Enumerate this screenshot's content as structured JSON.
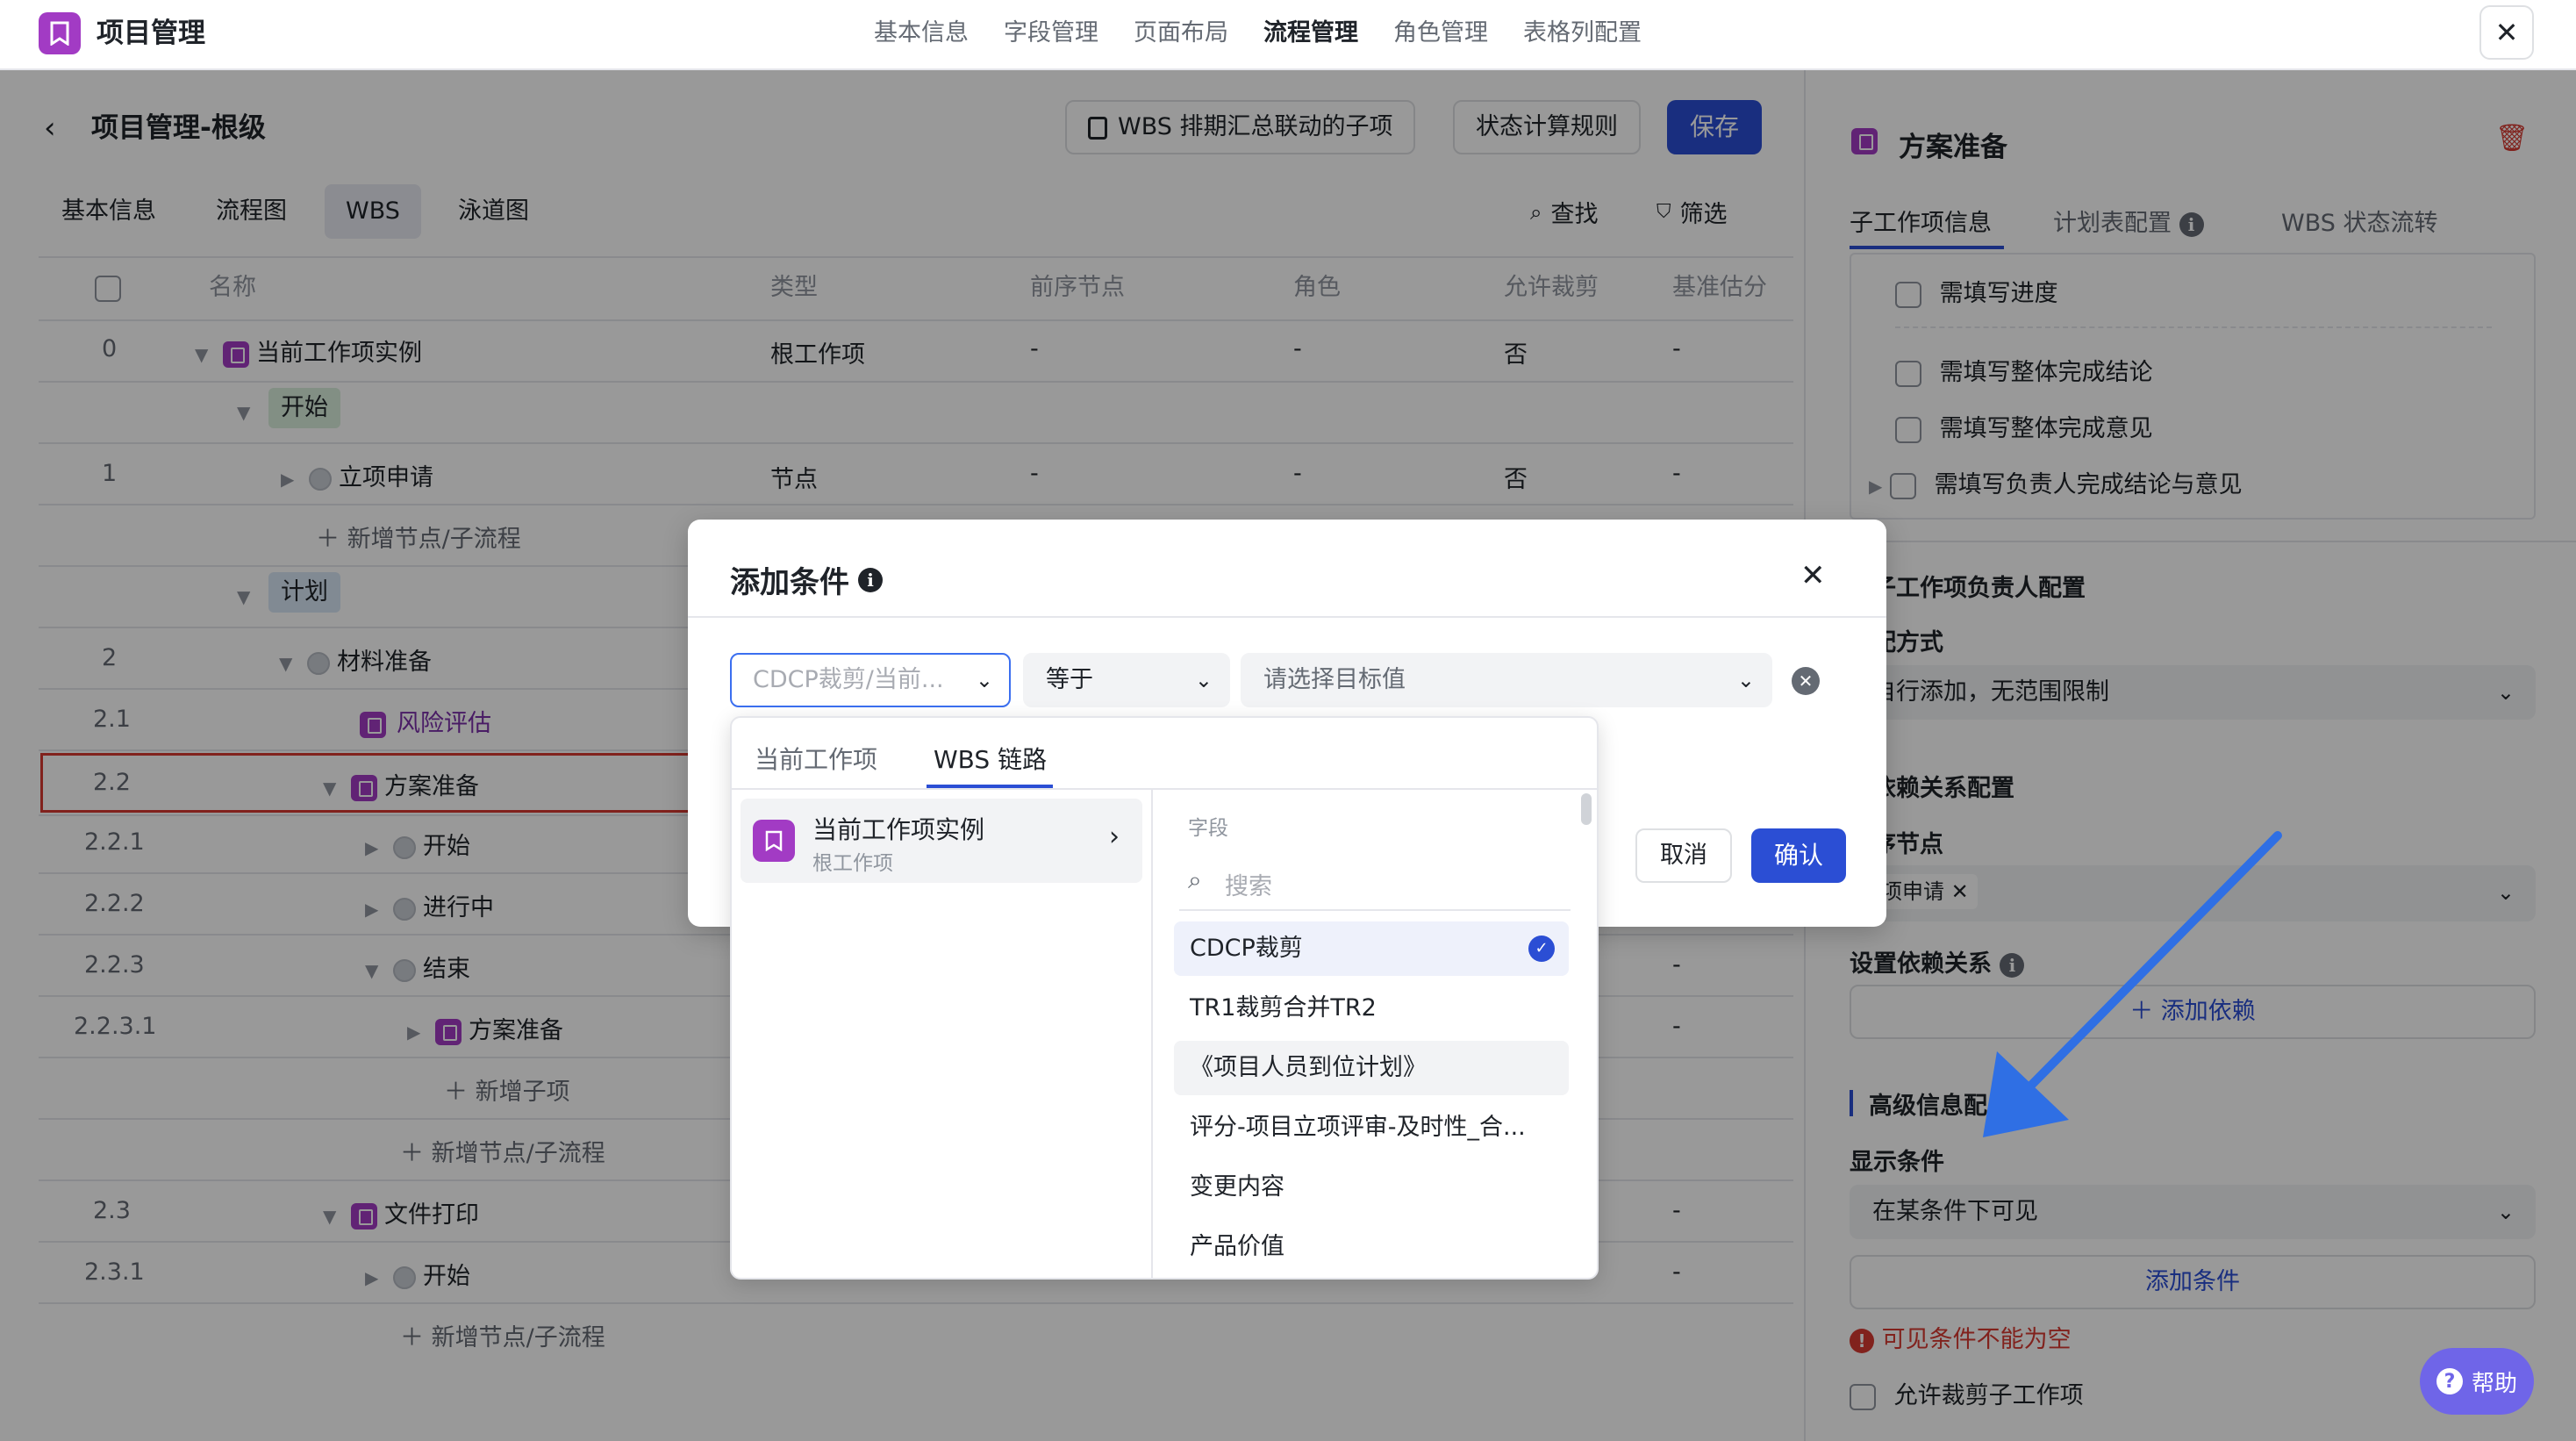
{
  "app": {
    "title": "项目管理"
  },
  "top_nav": [
    "基本信息",
    "字段管理",
    "页面布局",
    "流程管理",
    "角色管理",
    "表格列配置"
  ],
  "top_nav_active": "流程管理",
  "header": {
    "title": "项目管理-根级",
    "btn_wbs": "WBS 排期汇总联动的子项",
    "btn_rule": "状态计算规则",
    "btn_save": "保存"
  },
  "view_tabs": [
    "基本信息",
    "流程图",
    "WBS",
    "泳道图"
  ],
  "view_tab_active": "WBS",
  "tools": {
    "find": "查找",
    "filter": "筛选"
  },
  "table": {
    "columns": [
      "名称",
      "类型",
      "前序节点",
      "角色",
      "允许裁剪",
      "基准估分"
    ],
    "rows": [
      {
        "num": "0",
        "name": "当前工作项实例",
        "type": "根工作项",
        "pre": "-",
        "role": "-",
        "cut": "否",
        "est": "-"
      },
      {
        "phase": "开始"
      },
      {
        "num": "1",
        "name": "立项申请",
        "type": "节点",
        "pre": "-",
        "role": "-",
        "cut": "否",
        "est": "-"
      },
      {
        "add": "新增节点/子流程"
      },
      {
        "phase": "计划"
      },
      {
        "num": "2",
        "name": "材料准备"
      },
      {
        "num": "2.1",
        "name": "风险评估"
      },
      {
        "num": "2.2",
        "name": "方案准备"
      },
      {
        "num": "2.2.1",
        "name": "开始"
      },
      {
        "num": "2.2.2",
        "name": "进行中"
      },
      {
        "num": "2.2.3",
        "name": "结束",
        "est": "-"
      },
      {
        "num": "2.2.3.1",
        "name": "方案准备",
        "est": "-"
      },
      {
        "add": "新增子项"
      },
      {
        "add": "新增节点/子流程"
      },
      {
        "num": "2.3",
        "name": "文件打印",
        "est": "-"
      },
      {
        "num": "2.3.1",
        "name": "开始",
        "est": "-"
      },
      {
        "add": "新增节点/子流程"
      }
    ]
  },
  "right_panel": {
    "title": "方案准备",
    "tabs": [
      "子工作项信息",
      "计划表配置",
      "WBS 状态流转"
    ],
    "checks": [
      "需填写进度",
      "需填写整体完成结论",
      "需填写整体完成意见",
      "需填写负责人完成结论与意见"
    ],
    "owner_section": "子工作项负责人配置",
    "method_label": "配方式",
    "method_value": "自行添加，无范围限制",
    "dep_section": "依赖关系配置",
    "pre_label": "序节点",
    "pre_tag": "立项申请",
    "set_dep_label": "设置依赖关系",
    "add_dep": "添加依赖",
    "adv_section": "高级信息配",
    "show_cond_label": "显示条件",
    "show_cond_value": "在某条件下可见",
    "add_cond": "添加条件",
    "error": "可见条件不能为空",
    "allow_cut": "允许裁剪子工作项",
    "help": "帮助"
  },
  "modal": {
    "title": "添加条件",
    "field_placeholder": "CDCP裁剪/当前...",
    "operator": "等于",
    "target_placeholder": "请选择目标值",
    "cancel": "取消",
    "confirm": "确认"
  },
  "dropdown": {
    "tabs": [
      "当前工作项",
      "WBS 链路"
    ],
    "active_tab": "WBS 链路",
    "item_title": "当前工作项实例",
    "item_sub": "根工作项",
    "field_header": "字段",
    "search_placeholder": "搜索",
    "fields": [
      "CDCP裁剪",
      "TR1裁剪合并TR2",
      "《项目人员到位计划》",
      "评分-项目立项评审-及时性_合...",
      "变更内容",
      "产品价值"
    ],
    "selected_field": "CDCP裁剪"
  },
  "colors": {
    "accent": "#2b4ed4",
    "brand": "#a23bc4",
    "error": "#d83931",
    "arrow": "#2f6fe4"
  }
}
